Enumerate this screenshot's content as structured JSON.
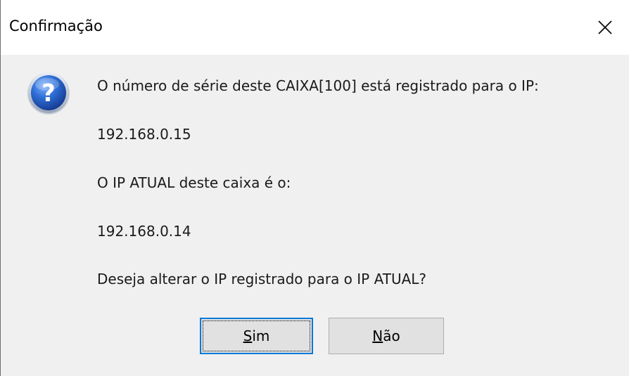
{
  "window": {
    "title": "Confirmação",
    "close_icon": "close-icon"
  },
  "dialog": {
    "icon": "question-icon",
    "icon_color": "#1f5fbf",
    "lines": [
      "O número de série deste CAIXA[100] está registrado para o IP:",
      "192.168.0.15",
      "O IP ATUAL deste caixa é o:",
      "192.168.0.14",
      "Deseja alterar o IP registrado para o IP ATUAL?"
    ]
  },
  "buttons": {
    "yes": {
      "mnemonic": "S",
      "rest": "im"
    },
    "no": {
      "mnemonic": "N",
      "rest": "ão"
    }
  }
}
